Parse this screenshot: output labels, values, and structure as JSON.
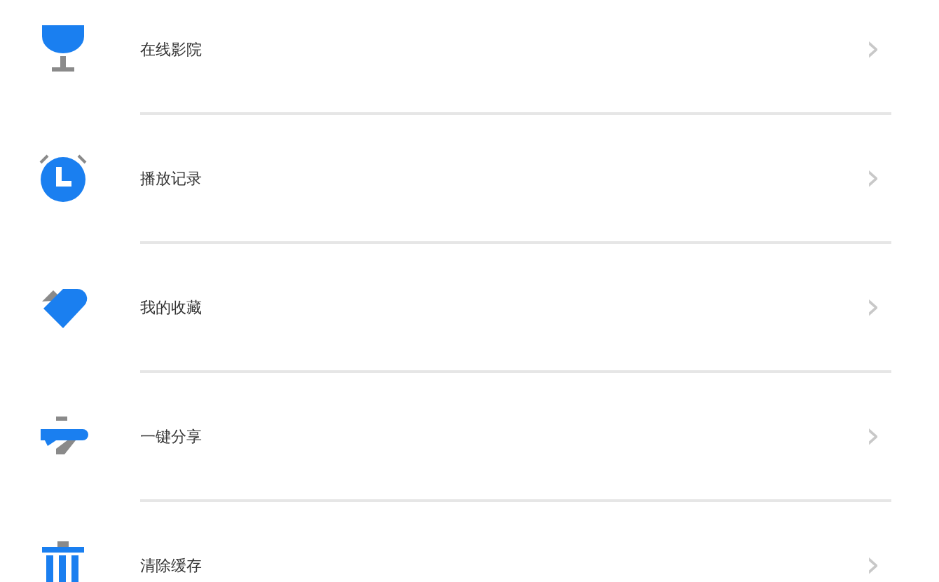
{
  "menu_items": [
    {
      "kind": "cinema",
      "label": "在线影院",
      "chevron": "›"
    },
    {
      "kind": "history",
      "label": "播放记录",
      "chevron": "›"
    },
    {
      "kind": "favorites",
      "label": "我的收藏",
      "chevron": "›"
    },
    {
      "kind": "share",
      "label": "一键分享",
      "chevron": "›"
    },
    {
      "kind": "cache",
      "label": "清除缓存",
      "chevron": "›"
    }
  ]
}
